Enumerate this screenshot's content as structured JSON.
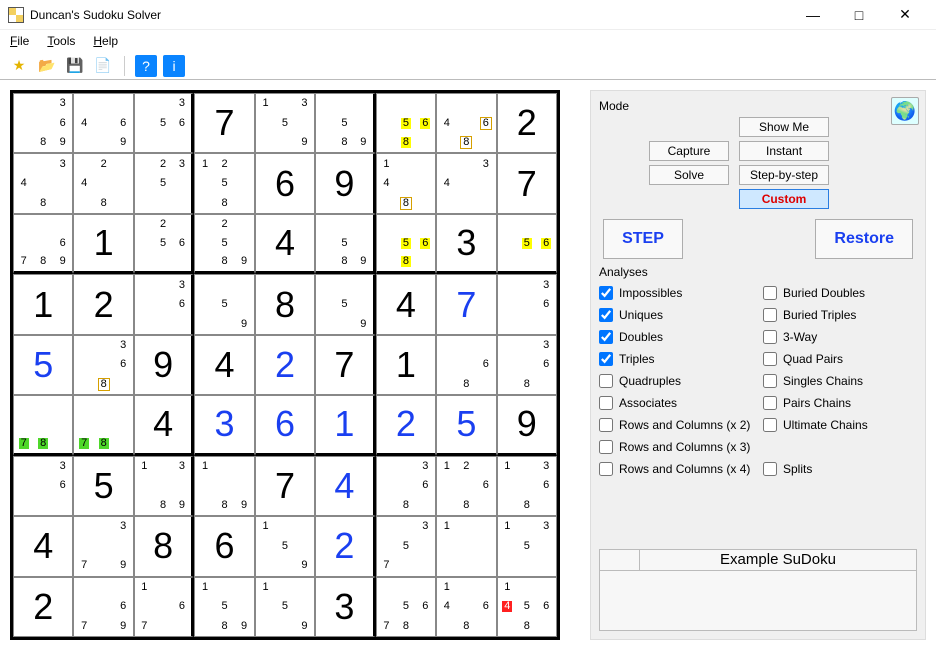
{
  "window": {
    "title": "Duncan's Sudoku Solver",
    "min": "—",
    "max": "□",
    "close": "✕"
  },
  "menu": {
    "file": "File",
    "tools": "Tools",
    "help": "Help"
  },
  "toolbar": {
    "fav": "★",
    "open": "📂",
    "save": "💾",
    "new": "📄",
    "help": "?",
    "info": "i"
  },
  "mode": {
    "legend": "Mode",
    "capture": "Capture",
    "solve": "Solve",
    "showme": "Show Me",
    "instant": "Instant",
    "stepbystep": "Step-by-step",
    "custom": "Custom"
  },
  "step_label": "STEP",
  "restore_label": "Restore",
  "analyses_legend": "Analyses",
  "analyses": [
    {
      "label": "Impossibles",
      "checked": true
    },
    {
      "label": "Buried Doubles",
      "checked": false
    },
    {
      "label": "Uniques",
      "checked": true
    },
    {
      "label": "Buried Triples",
      "checked": false
    },
    {
      "label": "Doubles",
      "checked": true
    },
    {
      "label": "3-Way",
      "checked": false
    },
    {
      "label": "Triples",
      "checked": true
    },
    {
      "label": "Quad Pairs",
      "checked": false
    },
    {
      "label": "Quadruples",
      "checked": false
    },
    {
      "label": "Singles Chains",
      "checked": false
    },
    {
      "label": "Associates",
      "checked": false
    },
    {
      "label": "Pairs Chains",
      "checked": false
    },
    {
      "label": "Rows and Columns (x 2)",
      "checked": false
    },
    {
      "label": "Ultimate Chains",
      "checked": false
    },
    {
      "label": "Rows and Columns (x 3)",
      "checked": false
    },
    {
      "label": "",
      "checked": null
    },
    {
      "label": "Rows and Columns (x 4)",
      "checked": false
    },
    {
      "label": "Splits",
      "checked": false
    }
  ],
  "example_label": "Example SuDoku",
  "grid": [
    [
      {
        "cands": [
          {
            "n": 3
          },
          {
            "n": 6
          },
          {
            "n": 8
          },
          {
            "n": 9
          }
        ]
      },
      {
        "cands": [
          {
            "n": 4
          },
          {
            "n": 6
          },
          {
            "n": 9
          }
        ]
      },
      {
        "cands": [
          {
            "n": 3
          },
          {
            "n": 5
          },
          {
            "n": 6
          }
        ]
      },
      {
        "big": "7"
      },
      {
        "cands": [
          {
            "n": 1
          },
          {
            "n": 3
          },
          {
            "n": 5
          },
          {
            "n": 9
          }
        ]
      },
      {
        "cands": [
          {
            "n": 5
          },
          {
            "n": 8
          },
          {
            "n": 9
          }
        ]
      },
      {
        "cands": [
          {
            "n": 5,
            "hl": "yellow"
          },
          {
            "n": 6,
            "hl": "yellow"
          },
          {
            "n": 8,
            "hl": "yellow"
          }
        ]
      },
      {
        "cands": [
          {
            "n": 4
          },
          {
            "n": 6,
            "hl": "yellow-border"
          },
          {
            "n": 8,
            "hl": "yellow-border"
          }
        ]
      },
      {
        "big": "2"
      }
    ],
    [
      {
        "cands": [
          {
            "n": 3
          },
          {
            "n": 4
          },
          {
            "n": 8
          }
        ]
      },
      {
        "cands": [
          {
            "n": 2
          },
          {
            "n": 4
          },
          {
            "n": 8
          }
        ]
      },
      {
        "cands": [
          {
            "n": 2
          },
          {
            "n": 3
          },
          {
            "n": 5
          }
        ]
      },
      {
        "cands": [
          {
            "n": 1
          },
          {
            "n": 2
          },
          {
            "n": 5
          },
          {
            "n": 8
          }
        ]
      },
      {
        "big": "6"
      },
      {
        "big": "9"
      },
      {
        "cands": [
          {
            "n": 1
          },
          {
            "n": 4
          },
          {
            "n": 8,
            "hl": "yellow-border"
          }
        ]
      },
      {
        "cands": [
          {
            "n": 3
          },
          {
            "n": 4
          }
        ]
      },
      {
        "big": "7"
      }
    ],
    [
      {
        "cands": [
          {
            "n": 6
          },
          {
            "n": 7
          },
          {
            "n": 8
          },
          {
            "n": 9
          }
        ]
      },
      {
        "big": "1"
      },
      {
        "cands": [
          {
            "n": 2
          },
          {
            "n": 5
          },
          {
            "n": 6
          }
        ]
      },
      {
        "cands": [
          {
            "n": 2
          },
          {
            "n": 5
          },
          {
            "n": 8
          },
          {
            "n": 9
          }
        ]
      },
      {
        "big": "4"
      },
      {
        "cands": [
          {
            "n": 5
          },
          {
            "n": 8
          },
          {
            "n": 9
          }
        ]
      },
      {
        "cands": [
          {
            "n": 5,
            "hl": "yellow"
          },
          {
            "n": 6,
            "hl": "yellow"
          },
          {
            "n": 8,
            "hl": "yellow"
          }
        ]
      },
      {
        "big": "3"
      },
      {
        "cands": [
          {
            "n": 5,
            "hl": "yellow"
          },
          {
            "n": 6,
            "hl": "yellow"
          }
        ]
      }
    ],
    [
      {
        "big": "1"
      },
      {
        "big": "2"
      },
      {
        "cands": [
          {
            "n": 3
          },
          {
            "n": 6
          }
        ]
      },
      {
        "cands": [
          {
            "n": 5
          },
          {
            "n": 9
          }
        ]
      },
      {
        "big": "8"
      },
      {
        "cands": [
          {
            "n": 5
          },
          {
            "n": 9
          }
        ]
      },
      {
        "big": "4"
      },
      {
        "big": "7",
        "color": "blue"
      },
      {
        "cands": [
          {
            "n": 3
          },
          {
            "n": 6
          }
        ]
      }
    ],
    [
      {
        "big": "5",
        "color": "blue"
      },
      {
        "cands": [
          {
            "n": 3
          },
          {
            "n": 6
          },
          {
            "n": 8,
            "hl": "yellow-border"
          }
        ]
      },
      {
        "big": "9"
      },
      {
        "big": "4"
      },
      {
        "big": "2",
        "color": "blue"
      },
      {
        "big": "7"
      },
      {
        "big": "1"
      },
      {
        "cands": [
          {
            "n": 6
          },
          {
            "n": 8
          }
        ]
      },
      {
        "cands": [
          {
            "n": 3
          },
          {
            "n": 6
          },
          {
            "n": 8
          }
        ]
      }
    ],
    [
      {
        "cands": [
          {
            "n": 7,
            "hl": "green"
          },
          {
            "n": 8,
            "hl": "green"
          }
        ]
      },
      {
        "cands": [
          {
            "n": 7,
            "hl": "green"
          },
          {
            "n": 8,
            "hl": "green"
          }
        ]
      },
      {
        "big": "4"
      },
      {
        "big": "3",
        "color": "blue"
      },
      {
        "big": "6",
        "color": "blue"
      },
      {
        "big": "1",
        "color": "blue"
      },
      {
        "big": "2",
        "color": "blue"
      },
      {
        "big": "5",
        "color": "blue"
      },
      {
        "big": "9"
      }
    ],
    [
      {
        "cands": [
          {
            "n": 3
          },
          {
            "n": 6
          }
        ]
      },
      {
        "big": "5"
      },
      {
        "cands": [
          {
            "n": 1
          },
          {
            "n": 3
          },
          {
            "n": 8
          },
          {
            "n": 9
          }
        ]
      },
      {
        "cands": [
          {
            "n": 1
          },
          {
            "n": 8
          },
          {
            "n": 9
          }
        ]
      },
      {
        "big": "7"
      },
      {
        "big": "4",
        "color": "blue"
      },
      {
        "cands": [
          {
            "n": 3
          },
          {
            "n": 6
          },
          {
            "n": 8
          }
        ]
      },
      {
        "cands": [
          {
            "n": 1
          },
          {
            "n": 2
          },
          {
            "n": 6
          },
          {
            "n": 8
          }
        ]
      },
      {
        "cands": [
          {
            "n": 1
          },
          {
            "n": 3
          },
          {
            "n": 6
          },
          {
            "n": 8
          }
        ]
      }
    ],
    [
      {
        "big": "4"
      },
      {
        "cands": [
          {
            "n": 3
          },
          {
            "n": 7
          },
          {
            "n": 9
          }
        ]
      },
      {
        "big": "8"
      },
      {
        "big": "6"
      },
      {
        "cands": [
          {
            "n": 1
          },
          {
            "n": 5
          },
          {
            "n": 9
          }
        ]
      },
      {
        "big": "2",
        "color": "blue"
      },
      {
        "cands": [
          {
            "n": 3
          },
          {
            "n": 5
          },
          {
            "n": 7
          }
        ]
      },
      {
        "cands": [
          {
            "n": 1
          }
        ]
      },
      {
        "cands": [
          {
            "n": 1
          },
          {
            "n": 3
          },
          {
            "n": 5
          }
        ]
      }
    ],
    [
      {
        "big": "2"
      },
      {
        "cands": [
          {
            "n": 6
          },
          {
            "n": 7
          },
          {
            "n": 9
          }
        ]
      },
      {
        "cands": [
          {
            "n": 1
          },
          {
            "n": 6
          },
          {
            "n": 7
          }
        ]
      },
      {
        "cands": [
          {
            "n": 1
          },
          {
            "n": 5
          },
          {
            "n": 8
          },
          {
            "n": 9
          }
        ]
      },
      {
        "cands": [
          {
            "n": 1
          },
          {
            "n": 5
          },
          {
            "n": 9
          }
        ]
      },
      {
        "big": "3"
      },
      {
        "cands": [
          {
            "n": 5
          },
          {
            "n": 6
          },
          {
            "n": 7
          },
          {
            "n": 8
          }
        ]
      },
      {
        "cands": [
          {
            "n": 1
          },
          {
            "n": 4
          },
          {
            "n": 6
          },
          {
            "n": 8
          }
        ]
      },
      {
        "cands": [
          {
            "n": 1
          },
          {
            "n": 4,
            "hl": "red"
          },
          {
            "n": 5
          },
          {
            "n": 6
          },
          {
            "n": 8
          }
        ]
      }
    ]
  ]
}
